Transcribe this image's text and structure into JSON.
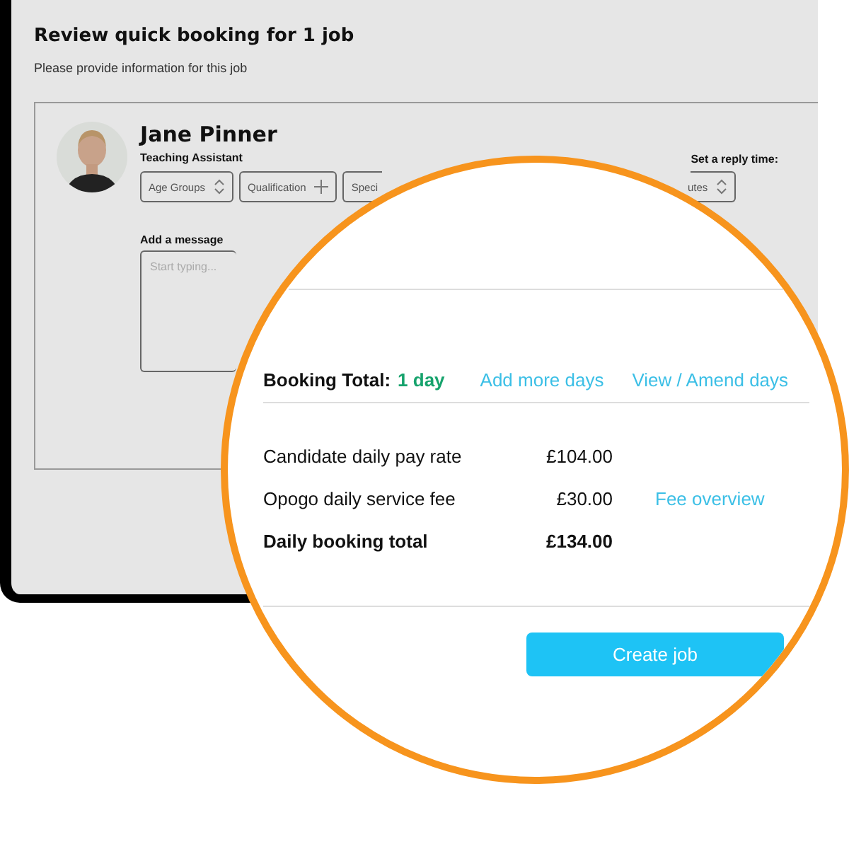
{
  "page": {
    "title": "Review quick booking for 1 job",
    "subtitle": "Please provide information for this job"
  },
  "candidate": {
    "name": "Jane Pinner",
    "role": "Teaching Assistant",
    "filters": [
      {
        "label": "Age Groups",
        "kind": "select"
      },
      {
        "label": "Qualification",
        "kind": "add"
      },
      {
        "label": "Speci",
        "kind": "plain"
      }
    ]
  },
  "reply_time": {
    "label": "Set a reply time:",
    "value": "utes"
  },
  "message": {
    "label": "Add a message",
    "placeholder": "Start typing..."
  },
  "booking": {
    "label": "Booking Total:",
    "value": "1 day",
    "links": [
      "Add more days",
      "View / Amend days"
    ]
  },
  "fees": [
    {
      "label": "Candidate daily pay rate",
      "amount": "£104.00",
      "kind": "normal"
    },
    {
      "label": "Opogo daily service fee",
      "amount": "£30.00",
      "link": "Fee overview",
      "kind": "normal"
    },
    {
      "label": "Daily booking total",
      "amount": "£134.00",
      "kind": "total"
    }
  ],
  "button": "Create job"
}
